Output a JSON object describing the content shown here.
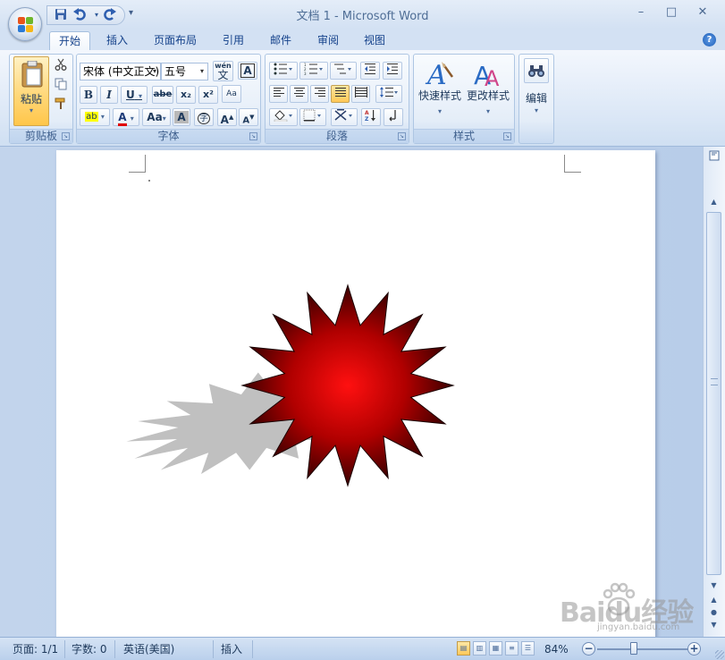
{
  "window": {
    "title": "文档 1 - Microsoft Word",
    "minimize_label": "–",
    "restore_label": "□",
    "close_label": "✕"
  },
  "quick_access": {
    "save_icon": "save-icon",
    "undo_icon": "undo-icon",
    "redo_icon": "redo-icon",
    "more_label": "▾"
  },
  "tabs": [
    {
      "label": "开始",
      "active": true
    },
    {
      "label": "插入"
    },
    {
      "label": "页面布局"
    },
    {
      "label": "引用"
    },
    {
      "label": "邮件"
    },
    {
      "label": "审阅"
    },
    {
      "label": "视图"
    }
  ],
  "help_label": "?",
  "ribbon": {
    "clipboard": {
      "label": "剪贴板",
      "paste_label": "粘贴",
      "paste_caret": "▾"
    },
    "font": {
      "label": "字体",
      "font_name": "宋体 (中文正文)",
      "font_size": "五号",
      "wen_label": "wén",
      "wen_char": "文",
      "border_char": "A",
      "bold": "B",
      "italic": "I",
      "underline": "U",
      "strike": "abe",
      "subscript": "x₂",
      "superscript": "x²",
      "clear_format": "Aa",
      "highlight": "ab",
      "font_color": "A",
      "change_case": "Aa",
      "char_shade": "A",
      "enclose": "字",
      "grow": "A",
      "shrink": "A"
    },
    "paragraph": {
      "label": "段落"
    },
    "styles": {
      "label": "样式",
      "quick_styles": "快速样式",
      "change_styles": "更改样式"
    },
    "editing": {
      "label": "编辑"
    }
  },
  "status": {
    "page": "页面: 1/1",
    "words": "字数: 0",
    "language": "英语(美国)",
    "insert_mode": "插入",
    "zoom": "84%"
  },
  "watermark": {
    "brand": "Baidu经验",
    "url": "jingyan.baidu.com"
  },
  "colors": {
    "star_center": "#ff1010",
    "star_edge": "#3a0000",
    "shadow": "#c0c0c0",
    "highlight_yellow": "#ffff00",
    "font_red": "#e00000"
  }
}
